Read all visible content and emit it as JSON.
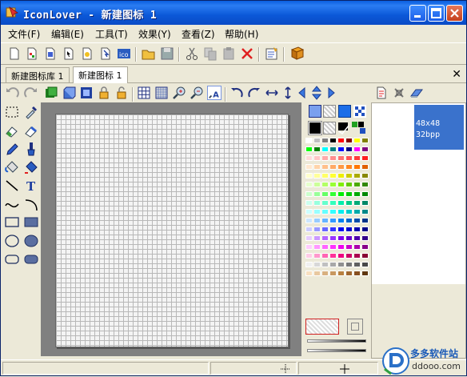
{
  "window": {
    "title": "IconLover - 新建图标 1"
  },
  "menu": [
    "文件(F)",
    "编辑(E)",
    "工具(T)",
    "效果(Y)",
    "查看(Z)",
    "帮助(H)"
  ],
  "tabs": [
    {
      "label": "新建图标库 1",
      "active": false
    },
    {
      "label": "新建图标 1",
      "active": true
    }
  ],
  "tab_close": "✕",
  "thumbnail": {
    "size": "48x48",
    "depth": "32bpp"
  },
  "watermark": {
    "brand": "多多软件站",
    "url": "ddooo.com"
  },
  "palette_colors": [
    "#ffffff",
    "#c0c0c0",
    "#808080",
    "#000000",
    "#ff0000",
    "#800000",
    "#ffff00",
    "#808000",
    "#00ff00",
    "#008000",
    "#00ffff",
    "#008080",
    "#0000ff",
    "#000080",
    "#ff00ff",
    "#800080",
    "#ffdada",
    "#ffc6c6",
    "#ffaaaa",
    "#ff8e8e",
    "#ff7272",
    "#ff5656",
    "#ff3a3a",
    "#ff1e1e",
    "#ffe8d0",
    "#ffd4aa",
    "#ffc08a",
    "#ffaa66",
    "#ff9944",
    "#ff8822",
    "#ff7700",
    "#e06000",
    "#ffffcc",
    "#ffff99",
    "#ffff66",
    "#ffff33",
    "#eeee00",
    "#cccc00",
    "#aaaa00",
    "#888800",
    "#e6ffcc",
    "#ccff99",
    "#b3ff66",
    "#99ff33",
    "#80ee00",
    "#66cc00",
    "#4daa00",
    "#338800",
    "#ccffcc",
    "#99ff99",
    "#66ff66",
    "#33ff33",
    "#00ee00",
    "#00cc00",
    "#00aa00",
    "#008800",
    "#ccffee",
    "#99ffdd",
    "#66ffcc",
    "#33ffbb",
    "#00eeaa",
    "#00cc88",
    "#00aa77",
    "#008866",
    "#ccffff",
    "#99ffff",
    "#66ffff",
    "#33ffff",
    "#00eeee",
    "#00cccc",
    "#00aaaa",
    "#008888",
    "#cce6ff",
    "#99ccff",
    "#66b3ff",
    "#3399ff",
    "#0080ee",
    "#0066cc",
    "#004daa",
    "#003388",
    "#ccccff",
    "#9999ff",
    "#6666ff",
    "#3333ff",
    "#0000ee",
    "#0000cc",
    "#0000aa",
    "#000088",
    "#e6ccff",
    "#cc99ff",
    "#b366ff",
    "#9933ff",
    "#8000ee",
    "#6600cc",
    "#4d00aa",
    "#330088",
    "#ffccff",
    "#ff99ff",
    "#ff66ff",
    "#ff33ff",
    "#ee00ee",
    "#cc00cc",
    "#aa00aa",
    "#880088",
    "#ffcce6",
    "#ff99cc",
    "#ff66b3",
    "#ff3399",
    "#ee0080",
    "#cc0066",
    "#aa004d",
    "#880033",
    "#f0f0f0",
    "#d8d8d8",
    "#c0c0c0",
    "#a8a8a8",
    "#909090",
    "#787878",
    "#606060",
    "#484848",
    "#f8e0c0",
    "#e8c8a0",
    "#d8b080",
    "#c89860",
    "#b88040",
    "#a06830",
    "#885020",
    "#603810"
  ]
}
